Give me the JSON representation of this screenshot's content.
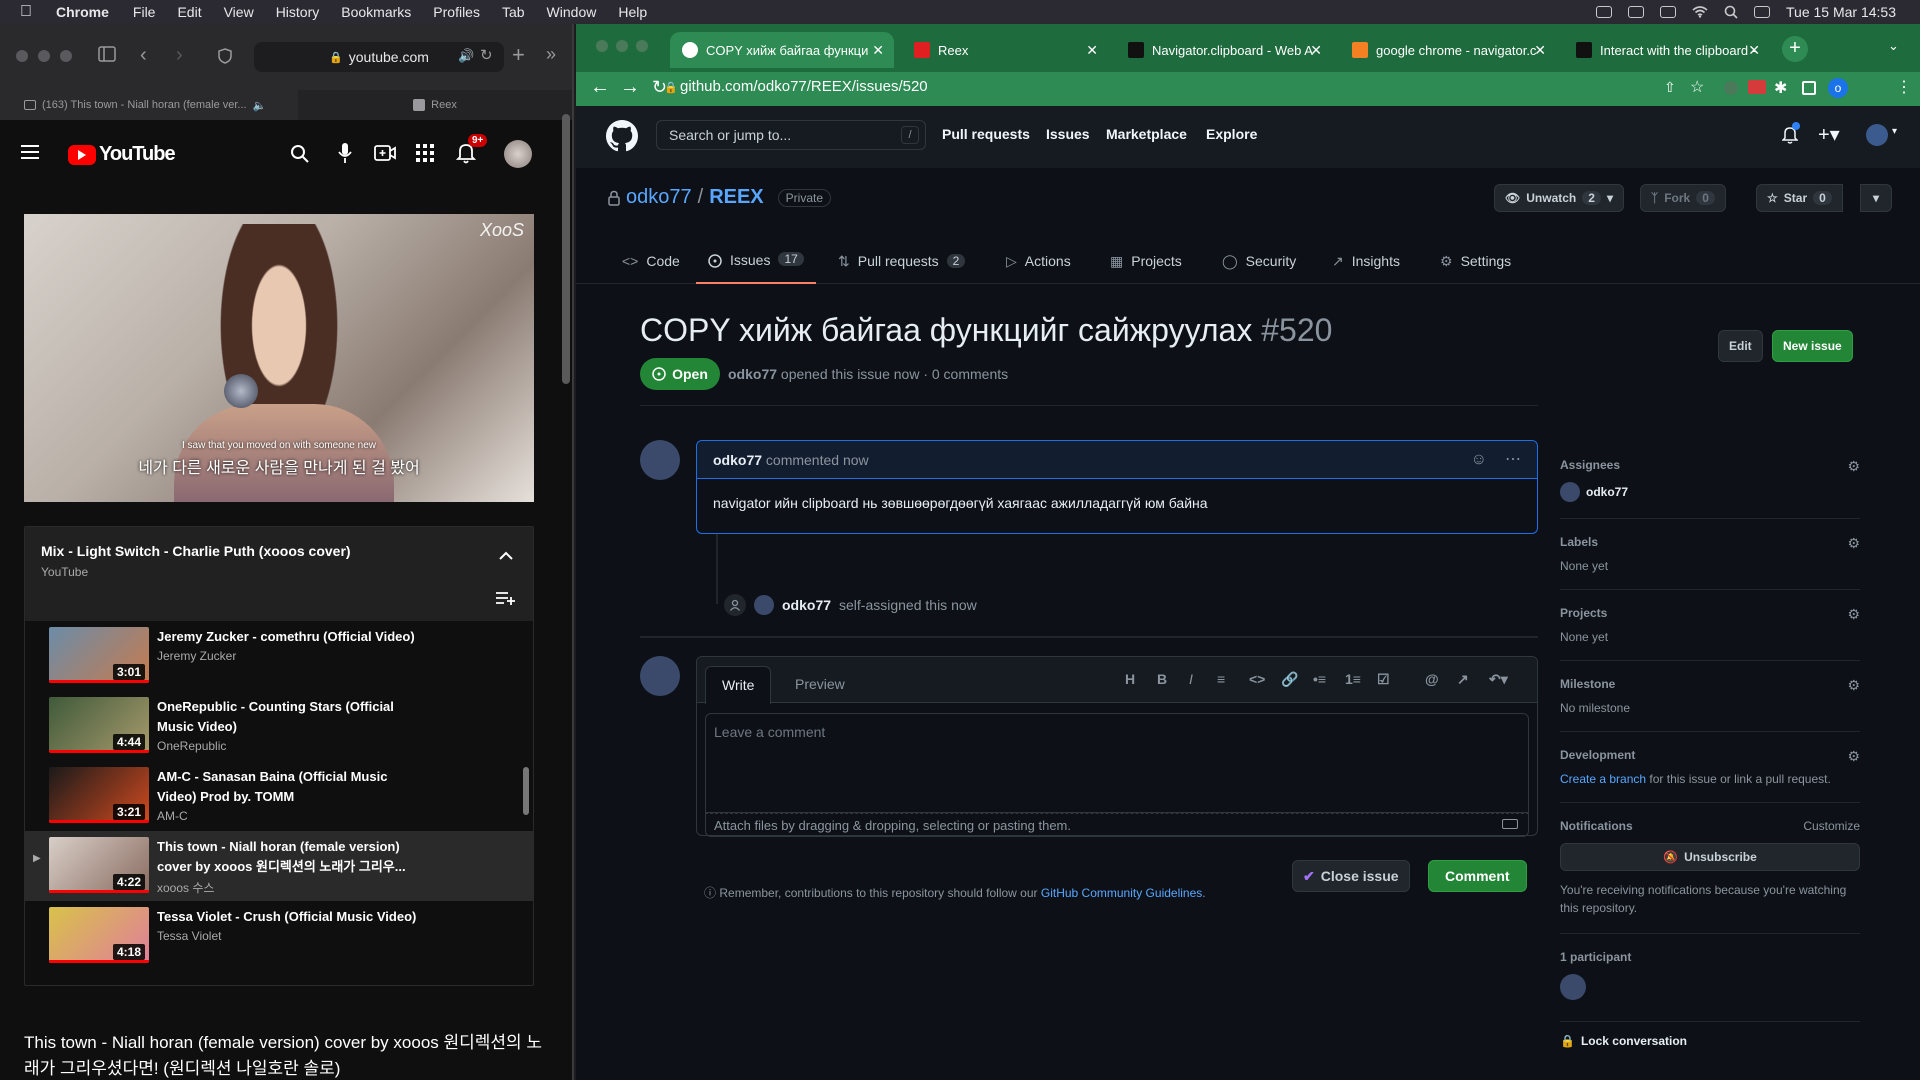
{
  "menubar": {
    "app": "Chrome",
    "items": [
      "File",
      "Edit",
      "View",
      "History",
      "Bookmarks",
      "Profiles",
      "Tab",
      "Window",
      "Help"
    ],
    "clock": "Tue 15 Mar  14:53"
  },
  "left_window": {
    "address": "youtube.com",
    "tabs": [
      "(163) This town - Niall horan (female ver...",
      "Reex"
    ],
    "notification_count": "9+",
    "video": {
      "watermark": "XooS",
      "subtitle_en": "I saw that you moved on with someone new",
      "subtitle_ko": "네가 다른 새로운 사람을 만나게 된 걸 봤어"
    },
    "playlist": {
      "title": "Mix - Light Switch - Charlie Puth (xooos cover)",
      "subtitle": "YouTube",
      "items": [
        {
          "name": "Jeremy Zucker - comethru (Official Video)",
          "channel": "Jeremy Zucker",
          "duration": "3:01",
          "colors": [
            "#6b8ca8",
            "#c77b4e"
          ]
        },
        {
          "name": "OneRepublic - Counting Stars (Official Music Video)",
          "channel": "OneRepublic",
          "duration": "4:44",
          "colors": [
            "#3f5a3a",
            "#a89a6c"
          ]
        },
        {
          "name": "AM-C - Sanasan Baina (Official Music Video) Prod by. TOMM",
          "channel": "AM-C",
          "duration": "3:21",
          "colors": [
            "#1a1a1a",
            "#d14a1f"
          ]
        },
        {
          "name": "This town - Niall horan (female version) cover by xooos 원디렉션의 노래가 그리우...",
          "channel": "xooos 수스",
          "duration": "4:22",
          "colors": [
            "#d8cfc8",
            "#8a6b60"
          ]
        },
        {
          "name": "Tessa Violet - Crush (Official Music Video)",
          "channel": "Tessa Violet",
          "duration": "4:18",
          "colors": [
            "#d8c24a",
            "#e07e9a"
          ]
        }
      ]
    },
    "video_title": "This town - Niall horan (female version) cover by xooos 원디렉션의 노래가 그리우셨다면! (원디렉션 나일호란 솔로)"
  },
  "right_window": {
    "tabs": [
      {
        "title": "COPY хийж байгаа функци",
        "active": true
      },
      {
        "title": "Reex"
      },
      {
        "title": "Navigator.clipboard - Web A"
      },
      {
        "title": "google chrome - navigator.c"
      },
      {
        "title": "Interact with the clipboard -"
      }
    ],
    "url": "github.com/odko77/REEX/issues/520",
    "profile_letter": "o",
    "gh": {
      "search_placeholder": "Search or jump to...",
      "search_key": "/",
      "nav": [
        "Pull requests",
        "Issues",
        "Marketplace",
        "Explore"
      ],
      "owner": "odko77",
      "repo": "REEX",
      "visibility": "Private",
      "watch_label": "Unwatch",
      "watch_count": "2",
      "fork_label": "Fork",
      "fork_count": "0",
      "star_label": "Star",
      "star_count": "0",
      "repo_tabs": [
        {
          "label": "Code",
          "count": ""
        },
        {
          "label": "Issues",
          "count": "17"
        },
        {
          "label": "Pull requests",
          "count": "2"
        },
        {
          "label": "Actions",
          "count": ""
        },
        {
          "label": "Projects",
          "count": ""
        },
        {
          "label": "Security",
          "count": ""
        },
        {
          "label": "Insights",
          "count": ""
        },
        {
          "label": "Settings",
          "count": ""
        }
      ],
      "issue": {
        "title": "COPY хийж байгаа функцийг сайжруулах",
        "number": "#520",
        "status": "Open",
        "author": "odko77",
        "meta": "opened this issue now · 0 comments",
        "edit_label": "Edit",
        "new_issue_label": "New issue",
        "comment_author": "odko77",
        "comment_time": "commented now",
        "comment_body": "navigator ийн clipboard нь зөвшөөрөгдөөгүй хаягаас ажилладаггүй юм байна",
        "assign_actor": "odko77",
        "assign_text": "self-assigned this now"
      },
      "editor": {
        "tab_write": "Write",
        "tab_preview": "Preview",
        "placeholder": "Leave a comment",
        "attach_text": "Attach files by dragging & dropping, selecting or pasting them.",
        "close_label": "Close issue",
        "comment_label": "Comment",
        "guidelines_text": "Remember, contributions to this repository should follow our",
        "guidelines_link": "GitHub Community Guidelines"
      },
      "sidebar": {
        "assignees_h": "Assignees",
        "assignee": "odko77",
        "labels_h": "Labels",
        "labels_v": "None yet",
        "projects_h": "Projects",
        "projects_v": "None yet",
        "milestone_h": "Milestone",
        "milestone_v": "No milestone",
        "development_h": "Development",
        "development_link": "Create a branch",
        "development_text": "for this issue or link a pull request.",
        "notifications_h": "Notifications",
        "customize": "Customize",
        "unsubscribe": "Unsubscribe",
        "notif_text": "You're receiving notifications because you're watching this repository.",
        "participants_h": "1 participant",
        "lock": "Lock conversation"
      }
    }
  }
}
